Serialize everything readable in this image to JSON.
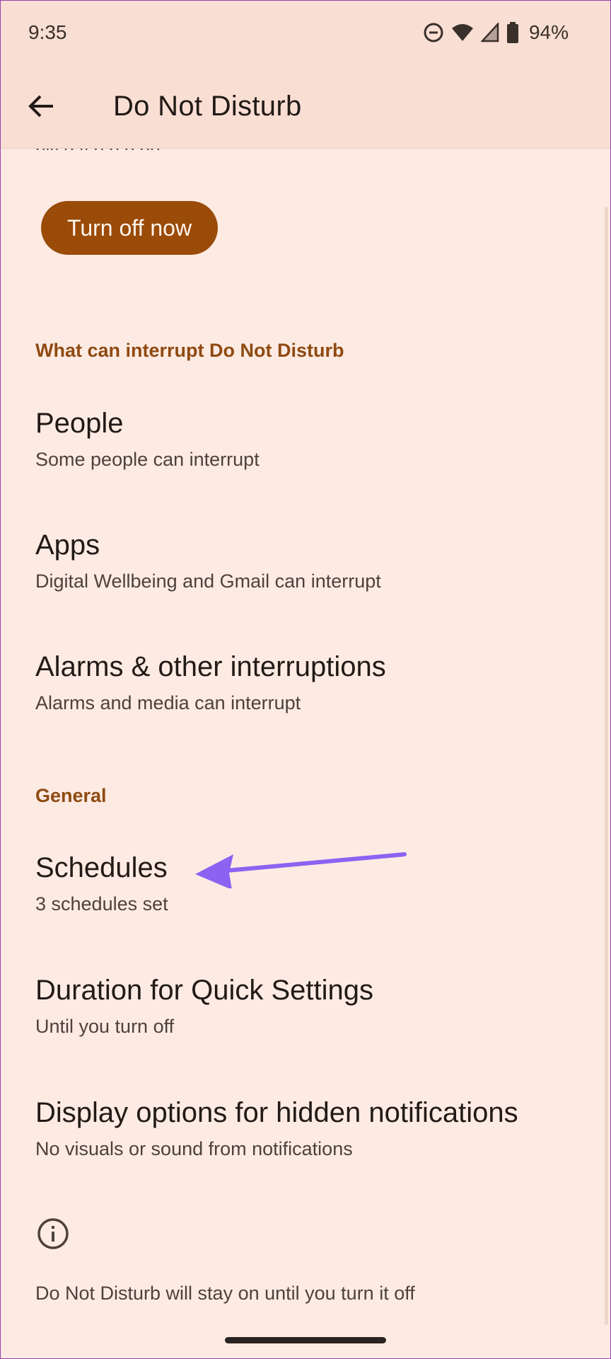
{
  "status_bar": {
    "time": "9:35",
    "battery_percent": "94%",
    "icons": [
      "dnd-icon",
      "wifi-icon",
      "signal-icon",
      "battery-icon"
    ]
  },
  "toolbar": {
    "back_icon": "arrow-left-icon",
    "title": "Do Not Disturb"
  },
  "cut_text": "nly g        y         p   p p     pp",
  "turn_off_button": {
    "label": "Turn off now"
  },
  "sections": {
    "interrupt_header": "What can interrupt Do Not Disturb",
    "general_header": "General"
  },
  "items": {
    "people": {
      "title": "People",
      "subtitle": "Some people can interrupt"
    },
    "apps": {
      "title": "Apps",
      "subtitle": "Digital Wellbeing and Gmail can interrupt"
    },
    "alarms": {
      "title": "Alarms & other interruptions",
      "subtitle": "Alarms and media can interrupt"
    },
    "schedules": {
      "title": "Schedules",
      "subtitle": "3 schedules set"
    },
    "duration": {
      "title": "Duration for Quick Settings",
      "subtitle": "Until you turn off"
    },
    "display": {
      "title": "Display options for hidden notifications",
      "subtitle": "No visuals or sound from notifications"
    }
  },
  "footer": {
    "info_icon": "info-icon",
    "text": "Do Not Disturb will stay on until you turn it off"
  },
  "colors": {
    "background": "#fdebe3",
    "appbar": "#f8ded3",
    "accent": "#9a4b08",
    "section_header": "#8f4a12",
    "annotation_arrow": "#8a63f2"
  }
}
